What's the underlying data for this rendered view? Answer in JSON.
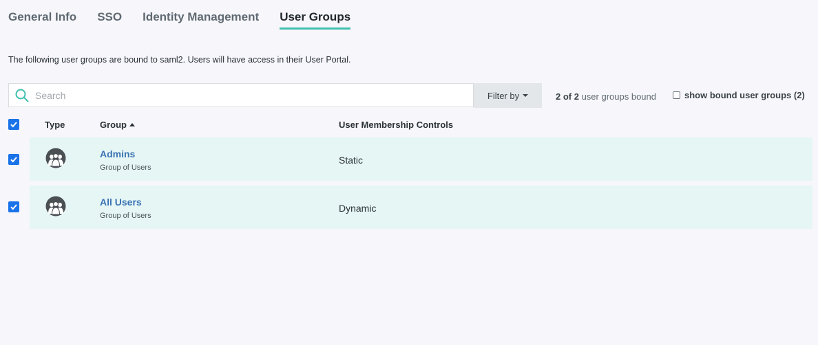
{
  "tabs": [
    {
      "label": "General Info",
      "active": false
    },
    {
      "label": "SSO",
      "active": false
    },
    {
      "label": "Identity Management",
      "active": false
    },
    {
      "label": "User Groups",
      "active": true
    }
  ],
  "description": "The following user groups are bound to saml2. Users will have access in their User Portal.",
  "search": {
    "placeholder": "Search",
    "value": ""
  },
  "filter": {
    "label": "Filter by"
  },
  "bound": {
    "count": "2 of 2",
    "suffix": " user groups bound"
  },
  "show_bound": {
    "label": "show bound user groups (2)",
    "checked": false
  },
  "table": {
    "columns": {
      "type": "Type",
      "group": "Group",
      "controls": "User Membership Controls"
    },
    "rows": [
      {
        "name": "Admins",
        "subtitle": "Group of Users",
        "control": "Static",
        "checked": true,
        "icon": "user-group-icon"
      },
      {
        "name": "All Users",
        "subtitle": "Group of Users",
        "control": "Dynamic",
        "checked": true,
        "icon": "user-group-icon"
      }
    ]
  },
  "colors": {
    "accent": "#3fbfae",
    "checkbox": "#1a73e8",
    "link": "#3b73b3",
    "row_bg": "#e6f6f5"
  }
}
